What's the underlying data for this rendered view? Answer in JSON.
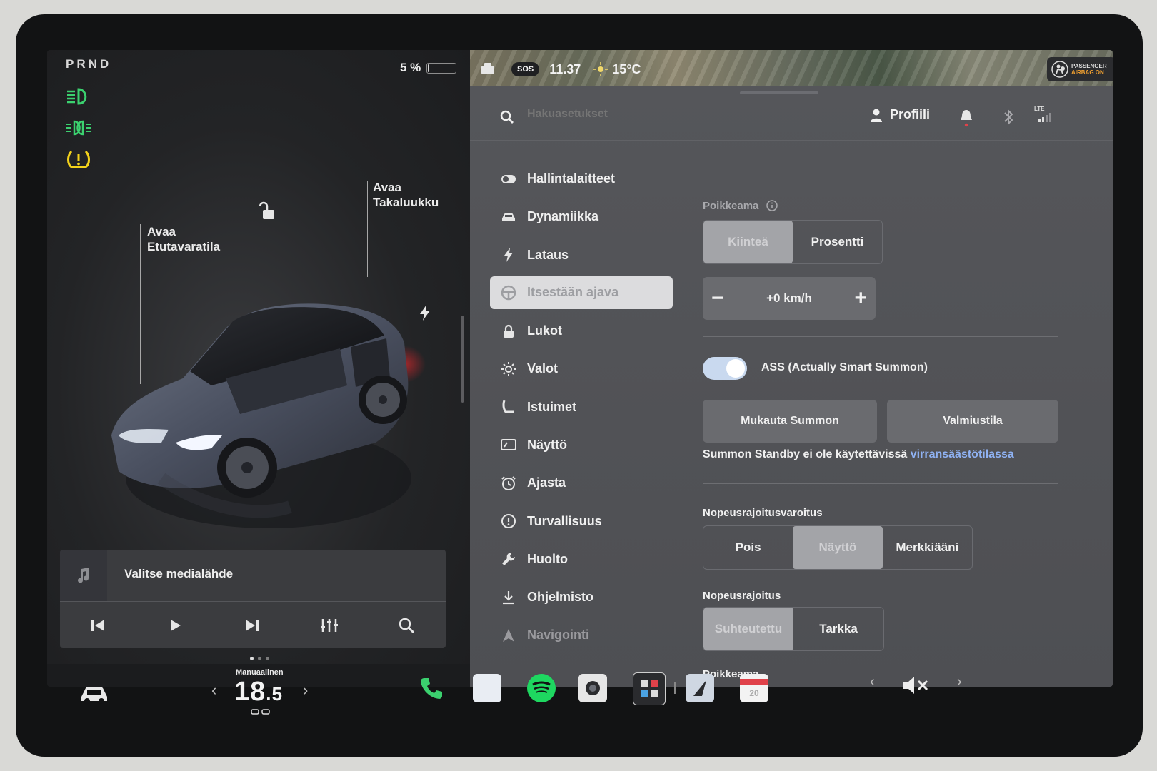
{
  "drive": {
    "gears": "PRND",
    "battery_percent": "5 %",
    "battery_level": 0.05
  },
  "car_labels": {
    "front_trunk": [
      "Avaa",
      "Etutavaratila"
    ],
    "rear_trunk": [
      "Avaa",
      "Takaluukku"
    ]
  },
  "status_bar": {
    "time": "11.37",
    "temperature": "15°C",
    "sos": "SOS",
    "airbag": [
      "PASSENGER",
      "AIRBAG ON"
    ]
  },
  "media": {
    "title": "Valitse medialähde"
  },
  "settings_header": {
    "search_placeholder": "Hakuasetukset",
    "profile_label": "Profiili",
    "network": "LTE"
  },
  "sidebar": {
    "items": [
      {
        "label": "Hallintalaitteet",
        "icon": "toggle-icon"
      },
      {
        "label": "Dynamiikka",
        "icon": "car-icon"
      },
      {
        "label": "Lataus",
        "icon": "bolt-icon"
      },
      {
        "label": "Itsestään ajava",
        "icon": "steering-wheel-icon",
        "active": true
      },
      {
        "label": "Lukot",
        "icon": "lock-icon"
      },
      {
        "label": "Valot",
        "icon": "sun-icon"
      },
      {
        "label": "Istuimet",
        "icon": "seat-icon"
      },
      {
        "label": "Näyttö",
        "icon": "display-icon"
      },
      {
        "label": "Ajasta",
        "icon": "alarm-icon"
      },
      {
        "label": "Turvallisuus",
        "icon": "alert-icon"
      },
      {
        "label": "Huolto",
        "icon": "wrench-icon"
      },
      {
        "label": "Ohjelmisto",
        "icon": "download-icon"
      },
      {
        "label": "Navigointi",
        "icon": "navigation-icon"
      }
    ]
  },
  "content": {
    "offset_label": "Poikkeama",
    "offset_mode": {
      "options": [
        "Kiinteä",
        "Prosentti"
      ],
      "selected": "Kiinteä"
    },
    "offset_value": "+0 km/h",
    "summon_label": "ASS (Actually Smart Summon)",
    "summon_enabled": true,
    "summon_buttons": [
      "Mukauta Summon",
      "Valmiustila"
    ],
    "standby_note": "Summon Standby ei ole käytettävissä",
    "standby_link": "virransäästötilassa",
    "speed_warning_label": "Nopeusrajoitusvaroitus",
    "speed_warning": {
      "options": [
        "Pois",
        "Näyttö",
        "Merkkiääni"
      ],
      "selected": "Näyttö"
    },
    "speed_limit_label": "Nopeusrajoitus",
    "speed_limit": {
      "options": [
        "Suhteutettu",
        "Tarkka"
      ],
      "selected": "Suhteutettu"
    },
    "offset_label_2": "Poikkeama"
  },
  "taskbar": {
    "climate_mode": "Manuaalinen",
    "temp_whole": "18",
    "temp_decimal": ".5",
    "calendar_day": "20"
  },
  "colors": {
    "accent_link": "#8fb2f3",
    "green_tell": "#3bd16f",
    "yellow_tell": "#f3d21b",
    "spotify": "#1ed760"
  }
}
